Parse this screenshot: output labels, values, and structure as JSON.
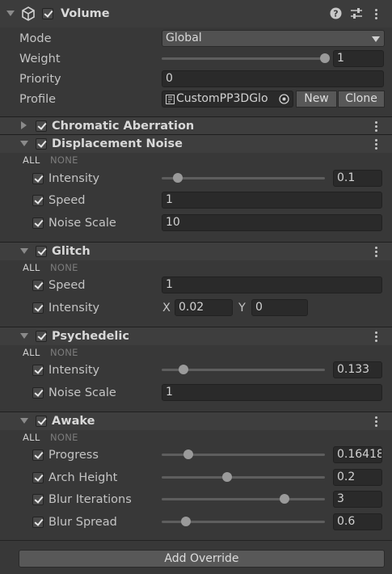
{
  "volume": {
    "title": "Volume",
    "mode_label": "Mode",
    "mode_value": "Global",
    "weight_label": "Weight",
    "weight_value": "1",
    "weight_fraction": 1.0,
    "priority_label": "Priority",
    "priority_value": "0",
    "profile_label": "Profile",
    "profile_value": "CustomPP3DGlo",
    "new_label": "New",
    "clone_label": "Clone"
  },
  "all_label": "ALL",
  "none_label": "NONE",
  "chromatic": {
    "title": "Chromatic Aberration"
  },
  "displacement": {
    "title": "Displacement Noise",
    "intensity_label": "Intensity",
    "intensity_value": "0.1",
    "intensity_fraction": 0.1,
    "speed_label": "Speed",
    "speed_value": "1",
    "noise_scale_label": "Noise Scale",
    "noise_scale_value": "10"
  },
  "glitch": {
    "title": "Glitch",
    "speed_label": "Speed",
    "speed_value": "1",
    "intensity_label": "Intensity",
    "x_label": "X",
    "x_value": "0.02",
    "y_label": "Y",
    "y_value": "0"
  },
  "psychedelic": {
    "title": "Psychedelic",
    "intensity_label": "Intensity",
    "intensity_value": "0.133",
    "intensity_fraction": 0.133,
    "noise_scale_label": "Noise Scale",
    "noise_scale_value": "1"
  },
  "awake": {
    "title": "Awake",
    "progress_label": "Progress",
    "progress_value": "0.16418",
    "progress_fraction": 0.164,
    "arch_height_label": "Arch Height",
    "arch_height_value": "0.2",
    "arch_height_fraction": 0.4,
    "blur_iterations_label": "Blur Iterations",
    "blur_iterations_value": "3",
    "blur_iterations_fraction": 0.75,
    "blur_spread_label": "Blur Spread",
    "blur_spread_value": "0.6",
    "blur_spread_fraction": 0.15
  },
  "add_override_label": "Add Override",
  "colors": {
    "background": "#383838",
    "header": "#3e3e3e",
    "field": "#2a2a2a",
    "text": "#c4c4c4"
  }
}
